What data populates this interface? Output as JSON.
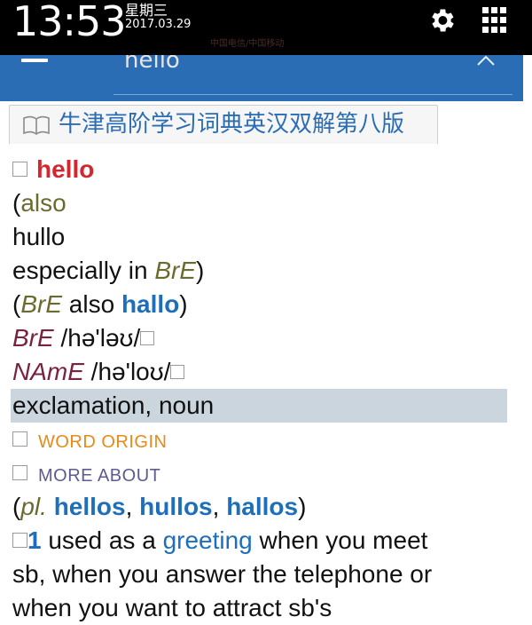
{
  "status": {
    "time": "13:53",
    "weekday": "星期三",
    "date": "2017.03.29",
    "carrier": "中国电信/中国移动"
  },
  "appbar": {
    "search_value": "hello"
  },
  "tab": {
    "label": "牛津高阶学习词典英汉双解第八版"
  },
  "entry": {
    "headword": "hello",
    "also_open": "(",
    "also_label": "also",
    "variant1": "hullo",
    "especially_text": "especially in ",
    "bre": "BrE",
    "close_paren": ")",
    "bre_also_open": "(",
    "bre_label": "BrE",
    "also_word": " also ",
    "variant2": "hallo",
    "bre_also_close": ")",
    "pron_bre_label": "BrE",
    "pron_bre": " /hə'ləʊ/",
    "pron_name_label": "NAmE",
    "pron_name": " /hə'loʊ/",
    "pos": "exclamation, noun",
    "word_origin": "WORD ORIGIN",
    "more_about": "MORE ABOUT",
    "plural_open": "(",
    "plural_label": "pl.",
    "plural1": "hellos",
    "comma1": ", ",
    "plural2": "hullos",
    "comma2": ", ",
    "plural3": "hallos",
    "plural_close": ")",
    "sense_num": "1",
    "def_part1": " used as a ",
    "def_link": "greeting",
    "def_part2": " when you meet",
    "def_line2": "sb, when you answer the telephone or",
    "def_line3": "when you want to attract sb's"
  }
}
